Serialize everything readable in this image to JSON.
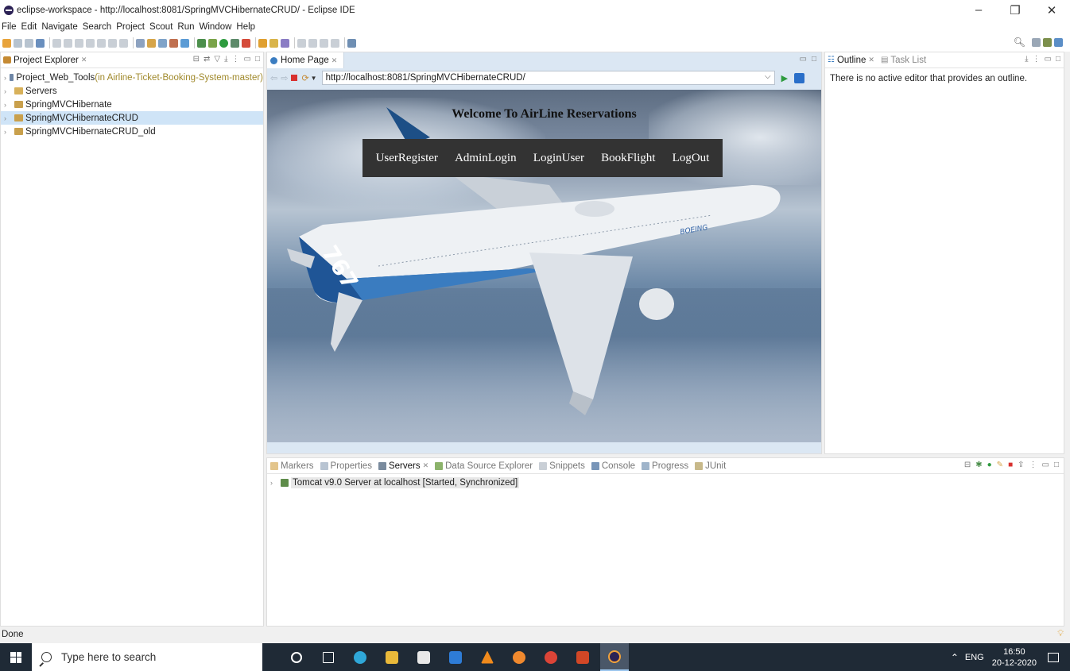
{
  "window": {
    "title": "eclipse-workspace - http://localhost:8081/SpringMVCHibernateCRUD/ - Eclipse IDE",
    "controls": [
      "–",
      "❐",
      "✕"
    ]
  },
  "menu": [
    "File",
    "Edit",
    "Navigate",
    "Search",
    "Project",
    "Scout",
    "Run",
    "Window",
    "Help"
  ],
  "project_explorer": {
    "title": "Project Explorer",
    "items": [
      {
        "label": "Project_Web_Tools",
        "suffix": " (in Airline-Ticket-Booking-System-master)"
      },
      {
        "label": "Servers",
        "suffix": ""
      },
      {
        "label": "SpringMVCHibernate",
        "suffix": ""
      },
      {
        "label": "SpringMVCHibernateCRUD",
        "suffix": ""
      },
      {
        "label": "SpringMVCHibernateCRUD_old",
        "suffix": ""
      }
    ]
  },
  "browser": {
    "tab_label": "Home Page",
    "url": "http://localhost:8081/SpringMVCHibernateCRUD/",
    "page": {
      "welcome": "Welcome To AirLine Reservations",
      "nav": [
        "UserRegister",
        "AdminLogin",
        "LoginUser",
        "BookFlight",
        "LogOut"
      ]
    }
  },
  "outline": {
    "tabs": [
      "Outline",
      "Task List"
    ],
    "message": "There is no active editor that provides an outline."
  },
  "bottom_panel": {
    "tabs": [
      "Markers",
      "Properties",
      "Servers",
      "Data Source Explorer",
      "Snippets",
      "Console",
      "Progress",
      "JUnit"
    ],
    "active_tab": "Servers",
    "server_entry": "Tomcat v9.0 Server at localhost  [Started, Synchronized]"
  },
  "status": "Done",
  "taskbar": {
    "search_placeholder": "Type here to search",
    "language": "ENG",
    "time": "16:50",
    "date": "20-12-2020"
  }
}
